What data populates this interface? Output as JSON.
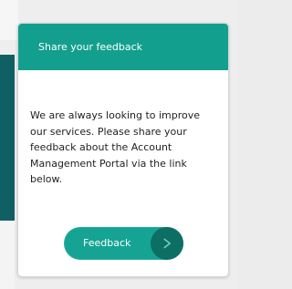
{
  "feedback_card": {
    "title": "Share your feedback",
    "message": "We are always looking to improve our services. Please share your feedback about the Account Management Portal via the link below.",
    "button_label": "Feedback",
    "button_icon": "play-icon"
  },
  "colors": {
    "header_green": "#139f8e",
    "button_green": "#15a493",
    "button_icon_green": "#0d6e63",
    "left_panel_teal": "#0f5f63"
  }
}
